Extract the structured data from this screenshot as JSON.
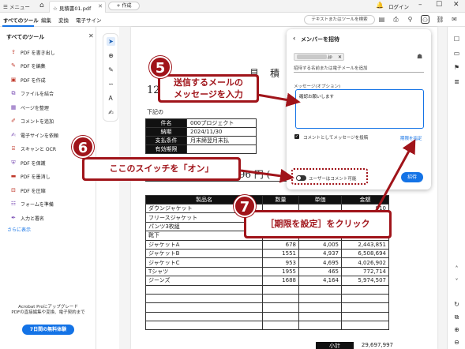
{
  "titlebar": {
    "menu": "メニュー",
    "tab_title": "見積書01.pdf",
    "new_label": "+ 作成",
    "login": "ログイン"
  },
  "toolbar": {
    "menu_items": [
      "すべてのツール",
      "編集",
      "変換",
      "電子サイン"
    ],
    "search": "テキストまたはツールを検索"
  },
  "left_panel": {
    "title": "すべてのツール",
    "items": [
      {
        "label": "PDF を書き出し",
        "icon": "export-pdf-icon"
      },
      {
        "label": "PDF を編集",
        "icon": "edit-pdf-icon"
      },
      {
        "label": "PDF を作成",
        "icon": "create-pdf-icon"
      },
      {
        "label": "ファイルを結合",
        "icon": "combine-files-icon"
      },
      {
        "label": "ページを整理",
        "icon": "organize-pages-icon"
      },
      {
        "label": "コメントを追加",
        "icon": "comment-icon"
      },
      {
        "label": "電子サインを依頼",
        "icon": "request-signature-icon"
      },
      {
        "label": "スキャンと OCR",
        "icon": "scan-ocr-icon"
      },
      {
        "label": "PDF を保護",
        "icon": "protect-pdf-icon"
      },
      {
        "label": "PDF を墨消し",
        "icon": "redact-pdf-icon"
      },
      {
        "label": "PDF を圧縮",
        "icon": "compress-pdf-icon"
      },
      {
        "label": "フォームを準備",
        "icon": "prepare-form-icon"
      },
      {
        "label": "入力と署名",
        "icon": "fill-sign-icon"
      }
    ],
    "more": "さらに表示",
    "promo_line1": "Acrobat Proにアップグレード",
    "promo_line2": "PDFの直接編集や変換、電子契約まで",
    "trial_button": "7日間の無料体験"
  },
  "document": {
    "title": "見積",
    "date": "12",
    "intro": "下記の",
    "info": [
      {
        "key": "件名",
        "value": "000プロジェクト"
      },
      {
        "key": "納期",
        "value": "2024/11/30"
      },
      {
        "key": "支払条件",
        "value": "月末締翌月末払"
      },
      {
        "key": "有効期限",
        "value": ""
      }
    ],
    "amount": "57,796 円 (",
    "headers": [
      "製品名",
      "数量",
      "単価",
      "金額"
    ],
    "rows": [
      [
        "ダウンジャケット",
        "",
        "",
        "910"
      ],
      [
        "フリースジャケット",
        "",
        "",
        "827"
      ],
      [
        "パンツ3枚組",
        "",
        "",
        ""
      ],
      [
        "靴下",
        "",
        "",
        "545"
      ],
      [
        "ジャケットA",
        "678",
        "4,005",
        "2,443,851"
      ],
      [
        "ジャケットB",
        "1551",
        "4,937",
        "6,508,694"
      ],
      [
        "ジャケットC",
        "953",
        "4,695",
        "4,026,902"
      ],
      [
        "Tシャツ",
        "1955",
        "465",
        "772,714"
      ],
      [
        "ジーンズ",
        "1688",
        "4,164",
        "5,974,507"
      ],
      [
        "",
        "",
        "",
        ""
      ],
      [
        "",
        "",
        "",
        ""
      ],
      [
        "",
        "",
        "",
        ""
      ],
      [
        "",
        "",
        "",
        ""
      ],
      [
        "",
        "",
        "",
        ""
      ]
    ],
    "subtotal_label": "小計",
    "subtotal_value": "29,697,997"
  },
  "invite": {
    "title": "メンバーを招待",
    "chip_suffix": ".jp",
    "hint": "招待する名前または電子メールを追加",
    "message_label": "メッセージ(オプション)",
    "message_value": "確認お願いします",
    "comment_checkbox": "コメントとしてメッセージを投稿",
    "deadline_link": "期限を指定",
    "toggle_label": "ユーザーはコメント可能",
    "send_button": "招待"
  },
  "annotations": {
    "badge5": "5",
    "callout5_line1": "送信するメールの",
    "callout5_line2": "メッセージを入力",
    "badge6": "6",
    "callout6": "ここのスイッチを「オン」",
    "badge7": "7",
    "callout7": "［期限を設定］をクリック",
    "color": "#a0141a"
  }
}
